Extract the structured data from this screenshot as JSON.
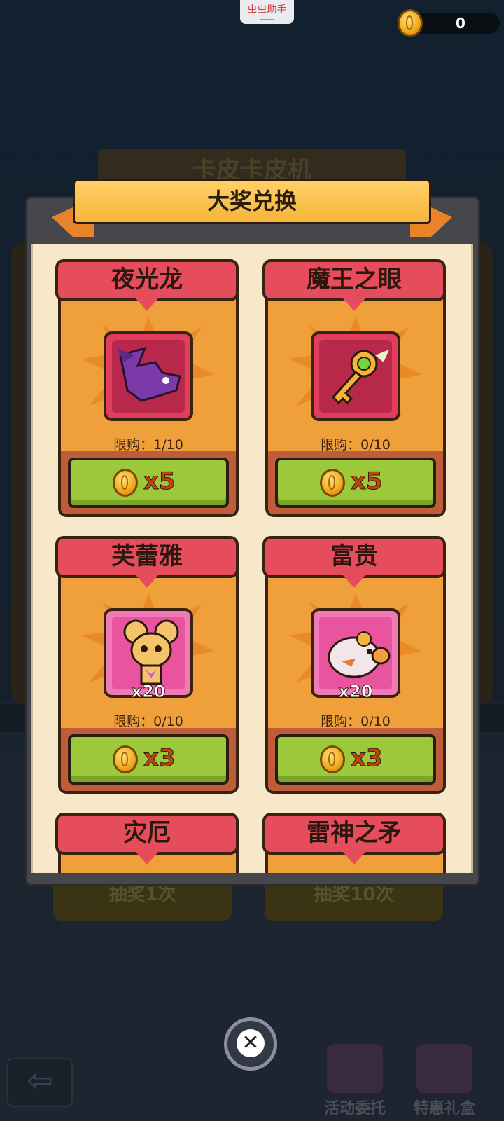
{
  "top": {
    "assistant_label": "虫虫助手",
    "coin_count": "0"
  },
  "background": {
    "title": "卡皮卡皮机",
    "draw_once": "抽奖1次",
    "draw_ten": "抽奖10次"
  },
  "modal": {
    "title": "大奖兑换",
    "items": [
      {
        "name": "夜光龙",
        "limit": "限购：1/10",
        "qty": "",
        "price": "x5"
      },
      {
        "name": "魔王之眼",
        "limit": "限购：0/10",
        "qty": "",
        "price": "x5"
      },
      {
        "name": "芙蕾雅",
        "limit": "限购：0/10",
        "qty": "x20",
        "price": "x3"
      },
      {
        "name": "富贵",
        "limit": "限购：0/10",
        "qty": "x20",
        "price": "x3"
      },
      {
        "name": "灾厄"
      },
      {
        "name": "雷神之矛"
      }
    ]
  },
  "bottom": {
    "tasks_label": "活动委托",
    "gift_label": "特惠礼盒"
  }
}
